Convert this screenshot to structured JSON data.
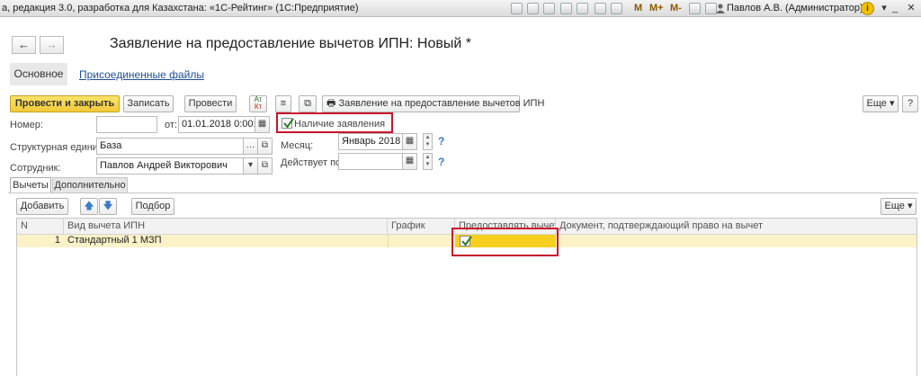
{
  "window": {
    "title": "а, редакция 3.0, разработка для Казахстана: «1С-Рейтинг»  (1С:Предприятие)",
    "memo_buttons": [
      "M",
      "M+",
      "M-"
    ],
    "user": "Павлов А.В. (Администратор)"
  },
  "form": {
    "title": "Заявление на предоставление вычетов ИПН: Новый *",
    "tabs": {
      "main": "Основное",
      "files": "Присоединенные файлы"
    }
  },
  "toolbar": {
    "post_close": "Провести и закрыть",
    "save": "Записать",
    "post": "Провести",
    "print": "Заявление на предоставление вычетов ИПН",
    "more": "Еще",
    "help": "?"
  },
  "fields": {
    "number_label": "Номер:",
    "number_value": "",
    "date_label": "от:",
    "date_value": "01.01.2018  0:00:00",
    "has_statement_label": "Наличие заявления",
    "has_statement_checked": true,
    "unit_label": "Структурная единица:",
    "unit_value": "База",
    "month_label": "Месяц:",
    "month_value": "Январь 2018",
    "employee_label": "Сотрудник:",
    "employee_value": "Павлов Андрей Викторович",
    "valid_label": "Действует по:",
    "valid_value": ""
  },
  "lower_tabs": {
    "deductions": "Вычеты",
    "additional": "Дополнительно"
  },
  "table_toolbar": {
    "add": "Добавить",
    "select": "Подбор",
    "more": "Еще"
  },
  "table": {
    "columns": [
      "N",
      "Вид вычета ИПН",
      "График",
      "Предоставлять вычет",
      "Документ, подтверждающий право на вычет"
    ],
    "rows": [
      {
        "n": "1",
        "kind": "Стандартный 1 МЗП",
        "schedule": "",
        "provide": true,
        "document": ""
      }
    ]
  },
  "colors": {
    "highlight": "#c8142a",
    "primary_button": "#f2c93a",
    "selected_row": "#fbf2c8",
    "selected_cell": "#f7cf1f"
  }
}
